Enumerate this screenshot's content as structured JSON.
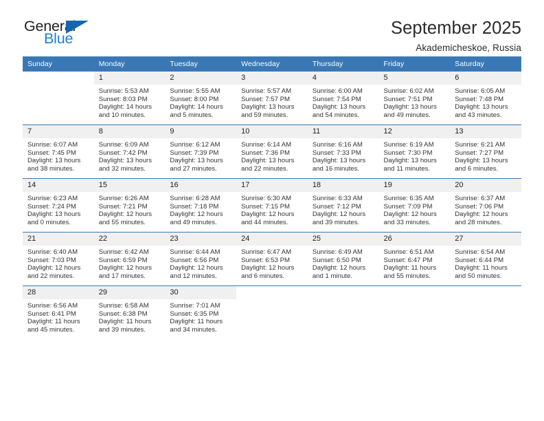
{
  "logo": {
    "word_top": "General",
    "word_bottom": "Blue",
    "triangle_icon": "triangle-icon",
    "accent_color": "#1a7fd4",
    "triangle_color": "#1565b0"
  },
  "header": {
    "title": "September 2025",
    "subtitle": "Akademicheskoe, Russia",
    "header_bg_color": "#3a78b5",
    "daynum_bg_color": "#f0f0f0"
  },
  "weekday_headers": [
    "Sunday",
    "Monday",
    "Tuesday",
    "Wednesday",
    "Thursday",
    "Friday",
    "Saturday"
  ],
  "labels": {
    "sunrise": "Sunrise:",
    "sunset": "Sunset:",
    "daylight": "Daylight:"
  },
  "weeks": [
    [
      {
        "day": "",
        "blank": true
      },
      {
        "day": "1",
        "sunrise": "Sunrise: 5:53 AM",
        "sunset": "Sunset: 8:03 PM",
        "daylight_1": "Daylight: 14 hours",
        "daylight_2": "and 10 minutes."
      },
      {
        "day": "2",
        "sunrise": "Sunrise: 5:55 AM",
        "sunset": "Sunset: 8:00 PM",
        "daylight_1": "Daylight: 14 hours",
        "daylight_2": "and 5 minutes."
      },
      {
        "day": "3",
        "sunrise": "Sunrise: 5:57 AM",
        "sunset": "Sunset: 7:57 PM",
        "daylight_1": "Daylight: 13 hours",
        "daylight_2": "and 59 minutes."
      },
      {
        "day": "4",
        "sunrise": "Sunrise: 6:00 AM",
        "sunset": "Sunset: 7:54 PM",
        "daylight_1": "Daylight: 13 hours",
        "daylight_2": "and 54 minutes."
      },
      {
        "day": "5",
        "sunrise": "Sunrise: 6:02 AM",
        "sunset": "Sunset: 7:51 PM",
        "daylight_1": "Daylight: 13 hours",
        "daylight_2": "and 49 minutes."
      },
      {
        "day": "6",
        "sunrise": "Sunrise: 6:05 AM",
        "sunset": "Sunset: 7:48 PM",
        "daylight_1": "Daylight: 13 hours",
        "daylight_2": "and 43 minutes."
      }
    ],
    [
      {
        "day": "7",
        "sunrise": "Sunrise: 6:07 AM",
        "sunset": "Sunset: 7:45 PM",
        "daylight_1": "Daylight: 13 hours",
        "daylight_2": "and 38 minutes."
      },
      {
        "day": "8",
        "sunrise": "Sunrise: 6:09 AM",
        "sunset": "Sunset: 7:42 PM",
        "daylight_1": "Daylight: 13 hours",
        "daylight_2": "and 32 minutes."
      },
      {
        "day": "9",
        "sunrise": "Sunrise: 6:12 AM",
        "sunset": "Sunset: 7:39 PM",
        "daylight_1": "Daylight: 13 hours",
        "daylight_2": "and 27 minutes."
      },
      {
        "day": "10",
        "sunrise": "Sunrise: 6:14 AM",
        "sunset": "Sunset: 7:36 PM",
        "daylight_1": "Daylight: 13 hours",
        "daylight_2": "and 22 minutes."
      },
      {
        "day": "11",
        "sunrise": "Sunrise: 6:16 AM",
        "sunset": "Sunset: 7:33 PM",
        "daylight_1": "Daylight: 13 hours",
        "daylight_2": "and 16 minutes."
      },
      {
        "day": "12",
        "sunrise": "Sunrise: 6:19 AM",
        "sunset": "Sunset: 7:30 PM",
        "daylight_1": "Daylight: 13 hours",
        "daylight_2": "and 11 minutes."
      },
      {
        "day": "13",
        "sunrise": "Sunrise: 6:21 AM",
        "sunset": "Sunset: 7:27 PM",
        "daylight_1": "Daylight: 13 hours",
        "daylight_2": "and 6 minutes."
      }
    ],
    [
      {
        "day": "14",
        "sunrise": "Sunrise: 6:23 AM",
        "sunset": "Sunset: 7:24 PM",
        "daylight_1": "Daylight: 13 hours",
        "daylight_2": "and 0 minutes."
      },
      {
        "day": "15",
        "sunrise": "Sunrise: 6:26 AM",
        "sunset": "Sunset: 7:21 PM",
        "daylight_1": "Daylight: 12 hours",
        "daylight_2": "and 55 minutes."
      },
      {
        "day": "16",
        "sunrise": "Sunrise: 6:28 AM",
        "sunset": "Sunset: 7:18 PM",
        "daylight_1": "Daylight: 12 hours",
        "daylight_2": "and 49 minutes."
      },
      {
        "day": "17",
        "sunrise": "Sunrise: 6:30 AM",
        "sunset": "Sunset: 7:15 PM",
        "daylight_1": "Daylight: 12 hours",
        "daylight_2": "and 44 minutes."
      },
      {
        "day": "18",
        "sunrise": "Sunrise: 6:33 AM",
        "sunset": "Sunset: 7:12 PM",
        "daylight_1": "Daylight: 12 hours",
        "daylight_2": "and 39 minutes."
      },
      {
        "day": "19",
        "sunrise": "Sunrise: 6:35 AM",
        "sunset": "Sunset: 7:09 PM",
        "daylight_1": "Daylight: 12 hours",
        "daylight_2": "and 33 minutes."
      },
      {
        "day": "20",
        "sunrise": "Sunrise: 6:37 AM",
        "sunset": "Sunset: 7:06 PM",
        "daylight_1": "Daylight: 12 hours",
        "daylight_2": "and 28 minutes."
      }
    ],
    [
      {
        "day": "21",
        "sunrise": "Sunrise: 6:40 AM",
        "sunset": "Sunset: 7:03 PM",
        "daylight_1": "Daylight: 12 hours",
        "daylight_2": "and 22 minutes."
      },
      {
        "day": "22",
        "sunrise": "Sunrise: 6:42 AM",
        "sunset": "Sunset: 6:59 PM",
        "daylight_1": "Daylight: 12 hours",
        "daylight_2": "and 17 minutes."
      },
      {
        "day": "23",
        "sunrise": "Sunrise: 6:44 AM",
        "sunset": "Sunset: 6:56 PM",
        "daylight_1": "Daylight: 12 hours",
        "daylight_2": "and 12 minutes."
      },
      {
        "day": "24",
        "sunrise": "Sunrise: 6:47 AM",
        "sunset": "Sunset: 6:53 PM",
        "daylight_1": "Daylight: 12 hours",
        "daylight_2": "and 6 minutes."
      },
      {
        "day": "25",
        "sunrise": "Sunrise: 6:49 AM",
        "sunset": "Sunset: 6:50 PM",
        "daylight_1": "Daylight: 12 hours",
        "daylight_2": "and 1 minute."
      },
      {
        "day": "26",
        "sunrise": "Sunrise: 6:51 AM",
        "sunset": "Sunset: 6:47 PM",
        "daylight_1": "Daylight: 11 hours",
        "daylight_2": "and 55 minutes."
      },
      {
        "day": "27",
        "sunrise": "Sunrise: 6:54 AM",
        "sunset": "Sunset: 6:44 PM",
        "daylight_1": "Daylight: 11 hours",
        "daylight_2": "and 50 minutes."
      }
    ],
    [
      {
        "day": "28",
        "sunrise": "Sunrise: 6:56 AM",
        "sunset": "Sunset: 6:41 PM",
        "daylight_1": "Daylight: 11 hours",
        "daylight_2": "and 45 minutes."
      },
      {
        "day": "29",
        "sunrise": "Sunrise: 6:58 AM",
        "sunset": "Sunset: 6:38 PM",
        "daylight_1": "Daylight: 11 hours",
        "daylight_2": "and 39 minutes."
      },
      {
        "day": "30",
        "sunrise": "Sunrise: 7:01 AM",
        "sunset": "Sunset: 6:35 PM",
        "daylight_1": "Daylight: 11 hours",
        "daylight_2": "and 34 minutes."
      },
      {
        "day": "",
        "blank": true
      },
      {
        "day": "",
        "blank": true
      },
      {
        "day": "",
        "blank": true
      },
      {
        "day": "",
        "blank": true
      }
    ]
  ]
}
